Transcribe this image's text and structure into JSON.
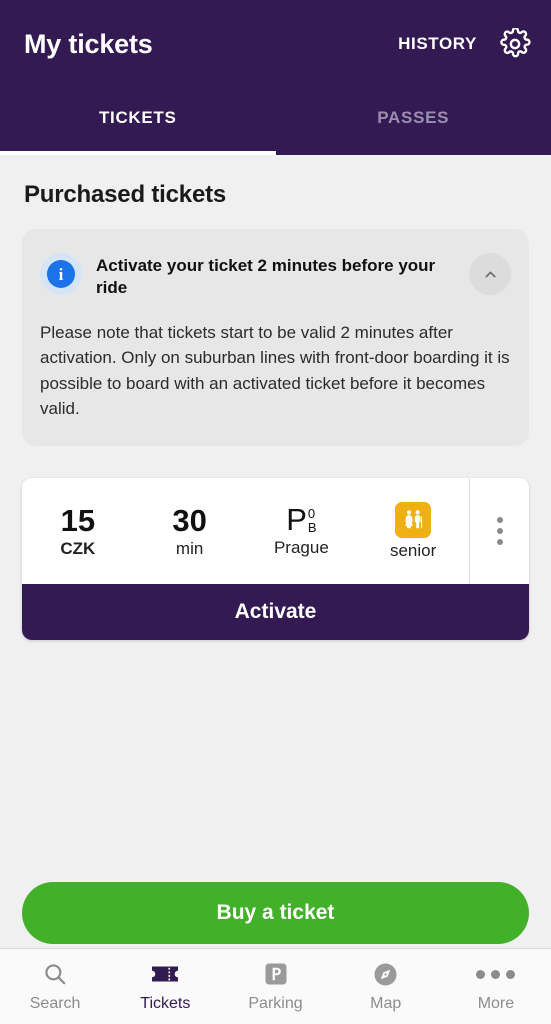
{
  "header": {
    "title": "My tickets",
    "history_label": "HISTORY",
    "gear_icon": "gear-icon",
    "tabs": [
      {
        "label": "TICKETS",
        "active": true
      },
      {
        "label": "PASSES",
        "active": false
      }
    ]
  },
  "main": {
    "section_title": "Purchased tickets",
    "notice": {
      "icon": "info-icon",
      "title": "Activate your ticket 2 minutes before your ride",
      "body": "Please note that tickets start to be valid 2 minutes after activation. Only on suburban lines with front-door boarding it is possible to board with an activated ticket before it becomes valid.",
      "collapse_icon": "chevron-up-icon"
    },
    "ticket": {
      "price_value": "15",
      "price_label": "CZK",
      "duration_value": "30",
      "duration_label": "min",
      "zone_letter": "P",
      "zone_superscript": "0",
      "zone_subscript": "B",
      "zone_label": "Prague",
      "passenger_icon": "senior-passengers-icon",
      "passenger_label": "senior",
      "menu_icon": "kebab-menu-icon",
      "activate_label": "Activate"
    }
  },
  "buy_button": {
    "label": "Buy a ticket",
    "color": "#43b02a"
  },
  "bottom_nav": [
    {
      "label": "Search",
      "icon": "search-icon",
      "active": false
    },
    {
      "label": "Tickets",
      "icon": "ticket-icon",
      "active": true
    },
    {
      "label": "Parking",
      "icon": "parking-icon",
      "active": false
    },
    {
      "label": "Map",
      "icon": "compass-icon",
      "active": false
    },
    {
      "label": "More",
      "icon": "more-dots-icon",
      "active": false
    }
  ],
  "colors": {
    "brand_purple": "#331a52",
    "accent_green": "#43b02a",
    "senior_amber": "#eeb111",
    "info_blue": "#1a73e8",
    "page_background": "#f0f0f0"
  }
}
